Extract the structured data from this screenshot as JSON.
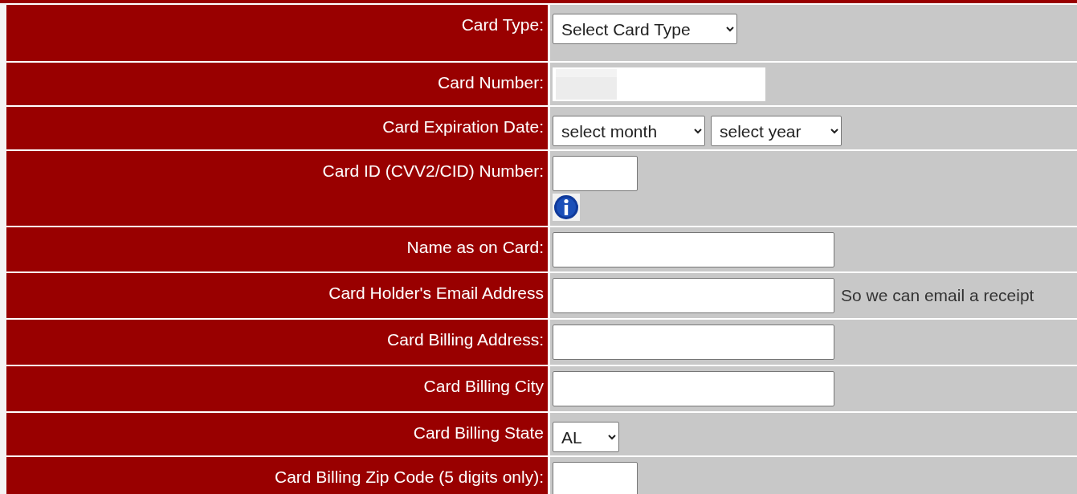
{
  "form_rows": [
    {
      "label": "Card Type:",
      "kind": "select",
      "options": [
        "Select Card Type"
      ]
    },
    {
      "label": "Card Number:",
      "kind": "masked-input"
    },
    {
      "label": "Card Expiration Date:",
      "kind": "select",
      "options": [
        "select month",
        "select year"
      ]
    },
    {
      "label": "Card ID (CVV2/CID) Number:",
      "kind": "info-input"
    },
    {
      "label": "Name as on Card:",
      "kind": "input"
    },
    {
      "label": "Card Holder's Email Address",
      "kind": "input",
      "note": "So we can email a receipt"
    },
    {
      "label": "Card Billing Address:",
      "kind": "input"
    },
    {
      "label": "Card Billing City",
      "kind": "input"
    },
    {
      "label": "Card Billing State",
      "kind": "select",
      "options": [
        "AL"
      ]
    },
    {
      "label": "Card Billing Zip Code (5 digits only):",
      "kind": "short-input"
    }
  ]
}
